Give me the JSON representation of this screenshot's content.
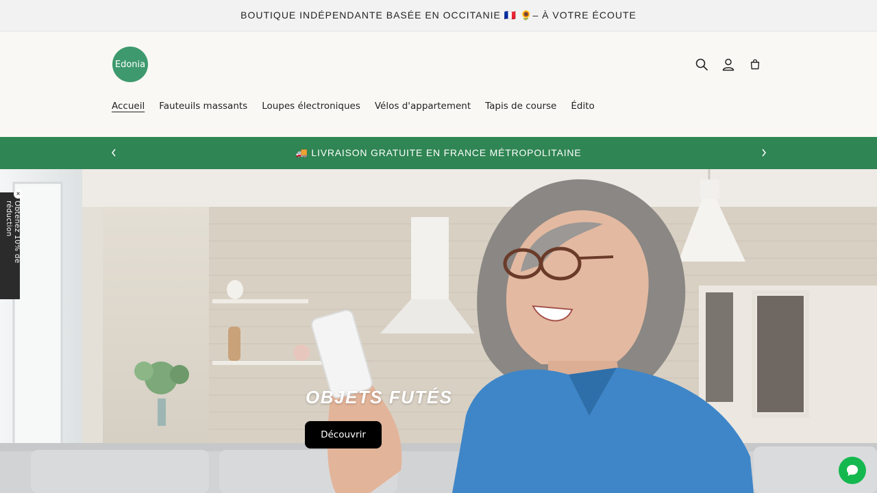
{
  "announcement": {
    "text": "BOUTIQUE INDÉPENDANTE BASÉE EN OCCITANIE 🇫🇷 🌻– À VOTRE ÉCOUTE"
  },
  "header": {
    "logo_text": "Edonia",
    "icons": [
      "search-icon",
      "account-icon",
      "cart-icon"
    ],
    "nav": [
      {
        "label": "Accueil",
        "active": true
      },
      {
        "label": "Fauteuils massants",
        "active": false
      },
      {
        "label": "Loupes électroniques",
        "active": false
      },
      {
        "label": "Vélos d'appartement",
        "active": false
      },
      {
        "label": "Tapis de course",
        "active": false
      },
      {
        "label": "Édito",
        "active": false
      }
    ]
  },
  "promo": {
    "text": "🚚 LIVRAISON GRATUITE EN FRANCE MÉTROPOLITAINE",
    "color": "#2f8553"
  },
  "hero": {
    "title": "OBJETS FUTÉS",
    "button_label": "Découvrir"
  },
  "discount_tab": {
    "label": "Obtenez 10% de réduction",
    "close": "×"
  },
  "chat": {
    "icon": "chat-bubble-icon",
    "color": "#14b84f"
  },
  "colors": {
    "brand": "#3e9a6e",
    "promo_bg": "#2f8553",
    "button": "#000000"
  }
}
